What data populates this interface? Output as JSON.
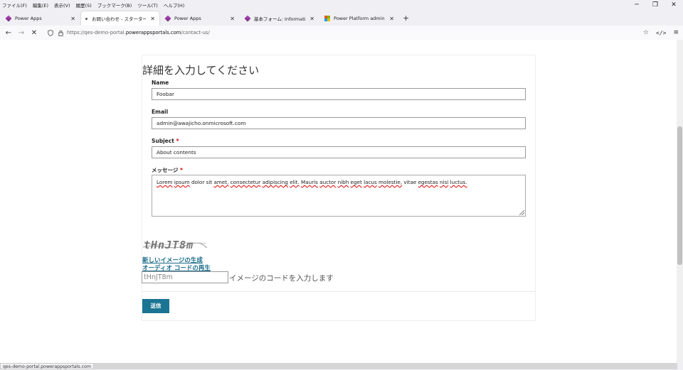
{
  "menu": [
    "ファイル(F)",
    "編集(E)",
    "表示(V)",
    "履歴(S)",
    "ブックマーク(B)",
    "ツール(T)",
    "ヘルプ(H)"
  ],
  "window_controls": {
    "minimize": "─",
    "restore": "❐",
    "close": "✕"
  },
  "tabs": [
    {
      "label": "Power Apps",
      "icon": "power-apps-icon",
      "active": false
    },
    {
      "label": "お問い合わせ - スターター ポータル",
      "icon": "loading-dot-icon",
      "active": true
    },
    {
      "label": "Power Apps",
      "icon": "power-apps-icon",
      "active": false
    },
    {
      "label": "基本フォーム: Information: Contac",
      "icon": "power-apps-icon",
      "active": false
    },
    {
      "label": "Power Platform admin center",
      "icon": "microsoft-logo-icon",
      "active": false
    }
  ],
  "tab_close": "✕",
  "new_tab": "+",
  "nav": {
    "back": "←",
    "forward": "→",
    "stop": "✕"
  },
  "url": {
    "prefix": "https://qes-demo-portal.",
    "host": "powerappsportals.com",
    "path": "/contact-us/"
  },
  "form": {
    "title": "詳細を入力してください",
    "fields": [
      {
        "label": "Name",
        "required": false,
        "value": "Foobar"
      },
      {
        "label": "Email",
        "required": false,
        "value": "admin@awajicho.onmicrosoft.com"
      },
      {
        "label": "Subject",
        "required": true,
        "value": "About contents"
      },
      {
        "label": "メッセージ",
        "required": true,
        "value": "Lorem ipsum dolor sit amet, consectetur adipiscing elit. Mauris auctor nibh eget lacus molestie, vitae egestas nisi luctus."
      }
    ],
    "required_mark": "*",
    "captcha": {
      "image_text": "tHnJT8m",
      "new_image_link": "新しいイメージの生成",
      "audio_link": "オーディオ コードの再生",
      "input_value": "tHnJT8m",
      "hint": "イメージのコードを入力します"
    },
    "submit_label": "送信"
  },
  "status_url": "qes-demo-portal.powerappsportals.com"
}
